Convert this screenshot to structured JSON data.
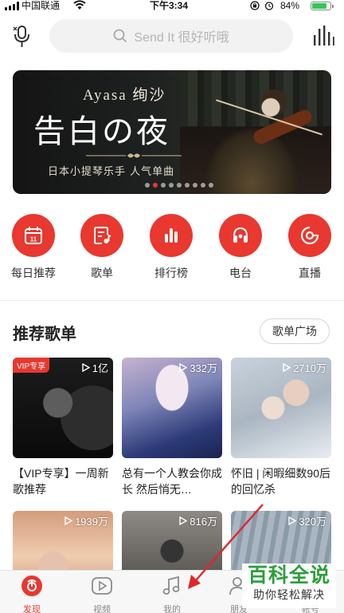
{
  "status_bar": {
    "carrier": "中国联通",
    "time": "下午3:34",
    "battery_percent": "84%",
    "battery_level": 0.84
  },
  "header": {
    "search_placeholder": "Send It 很好听哦",
    "icons": [
      "microphone-icon",
      "search-icon",
      "music-stats-icon"
    ]
  },
  "banner": {
    "artist": "Ayasa 绚沙",
    "headline": "告白の夜",
    "subline": "日本小提琴乐手 人气单曲",
    "page_count": 9,
    "active_page": 1
  },
  "shortcuts": [
    {
      "label": "每日推荐",
      "icon": "calendar-icon",
      "icon_text": "11"
    },
    {
      "label": "歌单",
      "icon": "playlist-icon"
    },
    {
      "label": "排行榜",
      "icon": "chart-bars-icon"
    },
    {
      "label": "电台",
      "icon": "radio-icon"
    },
    {
      "label": "直播",
      "icon": "live-icon"
    }
  ],
  "recommended": {
    "title": "推荐歌单",
    "more_button": "歌单广场",
    "playlists": [
      {
        "title": "【VIP专享】一周新歌推荐",
        "plays": "1亿",
        "badge": "VIP专享"
      },
      {
        "title": "总有一个人教会你成长 然后悄无…",
        "plays": "332万"
      },
      {
        "title": "怀旧 | 闲暇细数90后的回忆杀",
        "plays": "2710万"
      },
      {
        "title": "",
        "plays": "1939万"
      },
      {
        "title": "",
        "plays": "816万"
      },
      {
        "title": "",
        "plays": "320万"
      }
    ]
  },
  "tabbar": [
    {
      "label": "发现",
      "icon": "discover-icon",
      "active": true
    },
    {
      "label": "视频",
      "icon": "video-icon",
      "active": false
    },
    {
      "label": "我的",
      "icon": "music-note-icon",
      "active": false
    },
    {
      "label": "朋友",
      "icon": "friends-icon",
      "active": false
    },
    {
      "label": "帐号",
      "icon": "account-icon",
      "active": false
    }
  ],
  "watermark": {
    "big": "百科全说",
    "small": "助你轻松解决"
  },
  "colors": {
    "accent": "#e8382f",
    "watermark_green": "#2e9e3c"
  }
}
